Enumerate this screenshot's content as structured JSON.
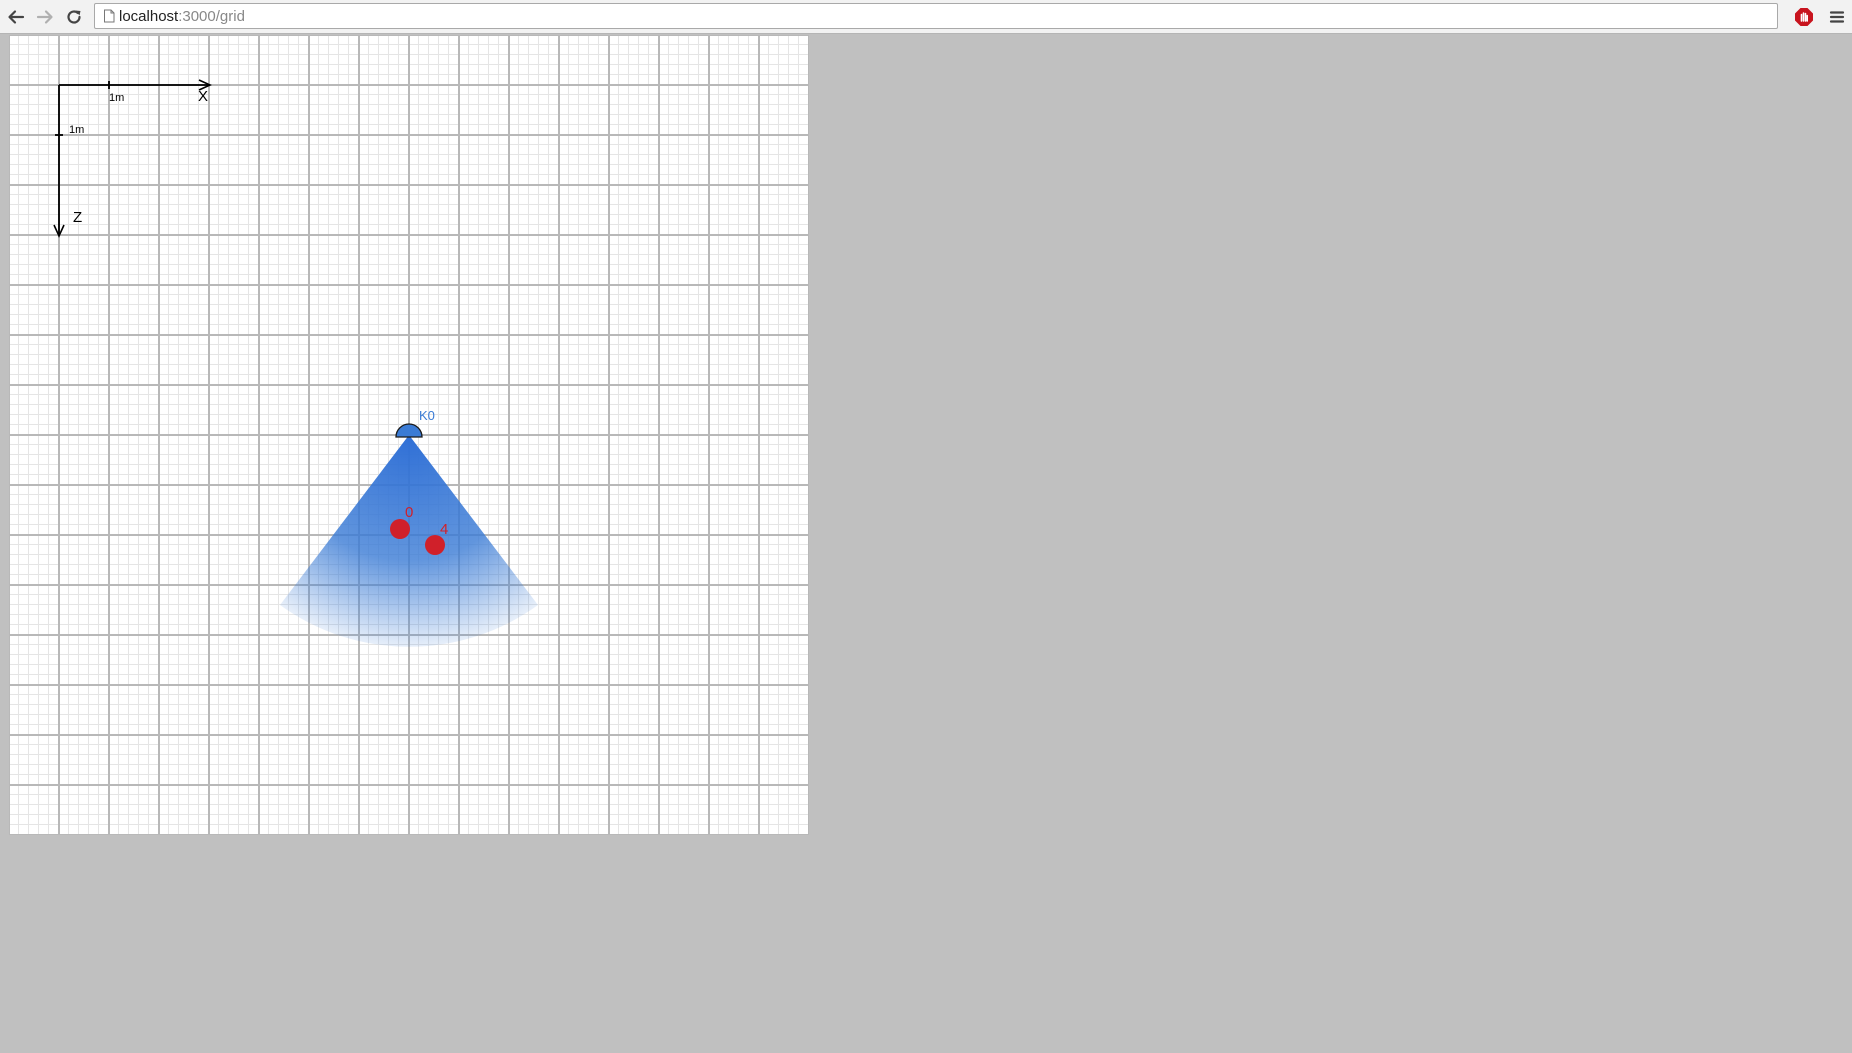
{
  "browser": {
    "url_host": "localhost",
    "url_path": ":3000/grid",
    "icons": {
      "back": "arrow-left-icon",
      "forward": "arrow-right-icon",
      "reload": "reload-icon",
      "page": "page-icon",
      "bookmark": "star-icon",
      "extension": "stop-sign-icon",
      "menu": "hamburger-menu-icon"
    }
  },
  "grid": {
    "axes": {
      "x_label": "X",
      "z_label": "Z",
      "x_scale_label": "1m",
      "z_scale_label": "1m"
    },
    "sensor": {
      "label": "K0",
      "color": "#3a7bd5"
    },
    "targets": [
      {
        "label": "0",
        "color": "#d0202a"
      },
      {
        "label": "4",
        "color": "#d0202a"
      }
    ],
    "colors": {
      "major_line": "#b8b8b8",
      "minor_line": "#e5e5e5",
      "cone": "#2f6fd6",
      "page_background": "#c0c0c0"
    }
  }
}
